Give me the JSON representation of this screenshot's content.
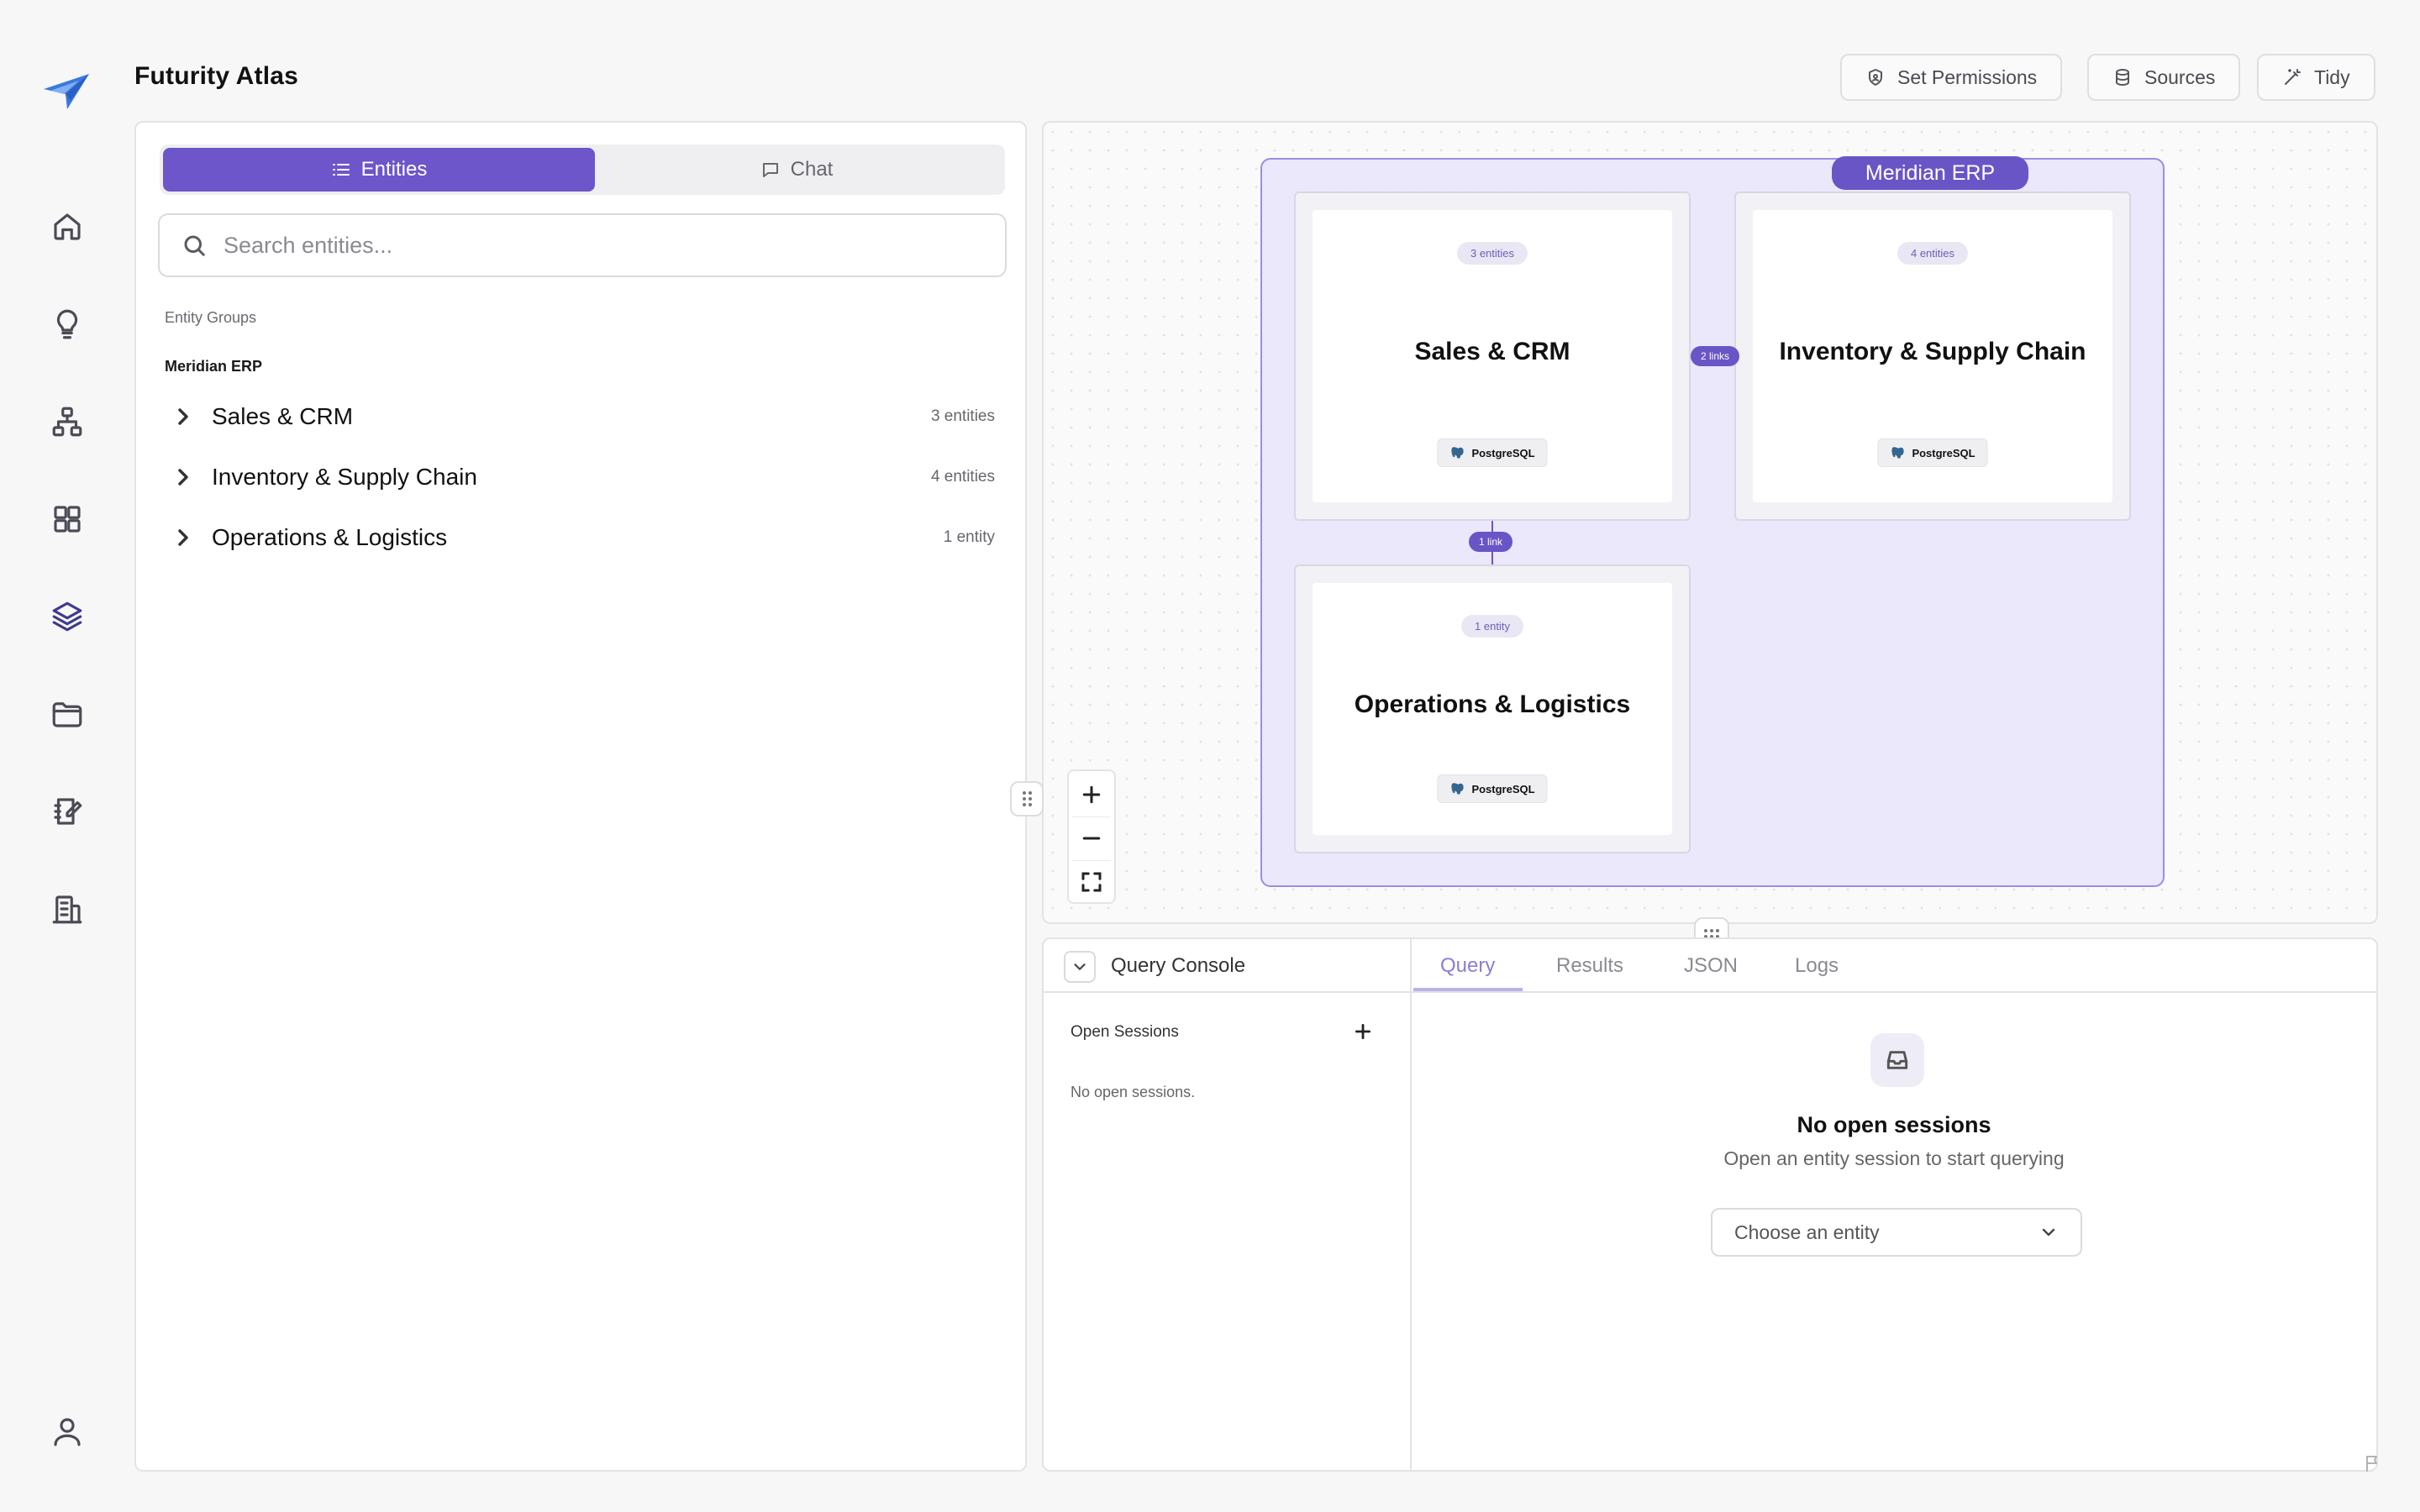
{
  "app": {
    "title": "Futurity Atlas"
  },
  "nav": {
    "items": [
      {
        "icon": "home-icon"
      },
      {
        "icon": "lightbulb-icon"
      },
      {
        "icon": "hierarchy-icon"
      },
      {
        "icon": "grid-icon"
      },
      {
        "icon": "layers-icon",
        "active": true
      },
      {
        "icon": "folder-icon"
      },
      {
        "icon": "notebook-icon"
      },
      {
        "icon": "building-icon"
      }
    ],
    "profile_icon": "user-icon"
  },
  "header": {
    "actions": [
      {
        "label": "Set Permissions",
        "icon": "shield-icon"
      },
      {
        "label": "Sources",
        "icon": "database-icon"
      },
      {
        "label": "Tidy",
        "icon": "wand-icon"
      }
    ]
  },
  "sidebar": {
    "tabs": [
      {
        "label": "Entities",
        "icon": "list-icon",
        "active": true
      },
      {
        "label": "Chat",
        "icon": "chat-icon",
        "active": false
      }
    ],
    "search": {
      "placeholder": "Search entities...",
      "value": ""
    },
    "section_label": "Entity Groups",
    "group_label": "Meridian ERP",
    "groups": [
      {
        "name": "Sales & CRM",
        "count": "3 entities"
      },
      {
        "name": "Inventory & Supply Chain",
        "count": "4 entities"
      },
      {
        "name": "Operations & Logistics",
        "count": "1 entity"
      }
    ]
  },
  "canvas": {
    "container_label": "Meridian ERP",
    "nodes": [
      {
        "title": "Sales & CRM",
        "badge": "3 entities",
        "source": "PostgreSQL"
      },
      {
        "title": "Inventory & Supply Chain",
        "badge": "4 entities",
        "source": "PostgreSQL"
      },
      {
        "title": "Operations & Logistics",
        "badge": "1 entity",
        "source": "PostgreSQL"
      }
    ],
    "links": [
      {
        "label": "2 links"
      },
      {
        "label": "1 link"
      }
    ],
    "accent": "#6a55c6"
  },
  "console": {
    "title": "Query Console",
    "tabs": [
      {
        "label": "Query",
        "active": true
      },
      {
        "label": "Results"
      },
      {
        "label": "JSON"
      },
      {
        "label": "Logs"
      }
    ],
    "sessions_label": "Open Sessions",
    "sessions_empty": "No open sessions.",
    "empty_title": "No open sessions",
    "empty_subtitle": "Open an entity session to start querying",
    "entity_select": {
      "placeholder": "Choose an entity"
    }
  }
}
